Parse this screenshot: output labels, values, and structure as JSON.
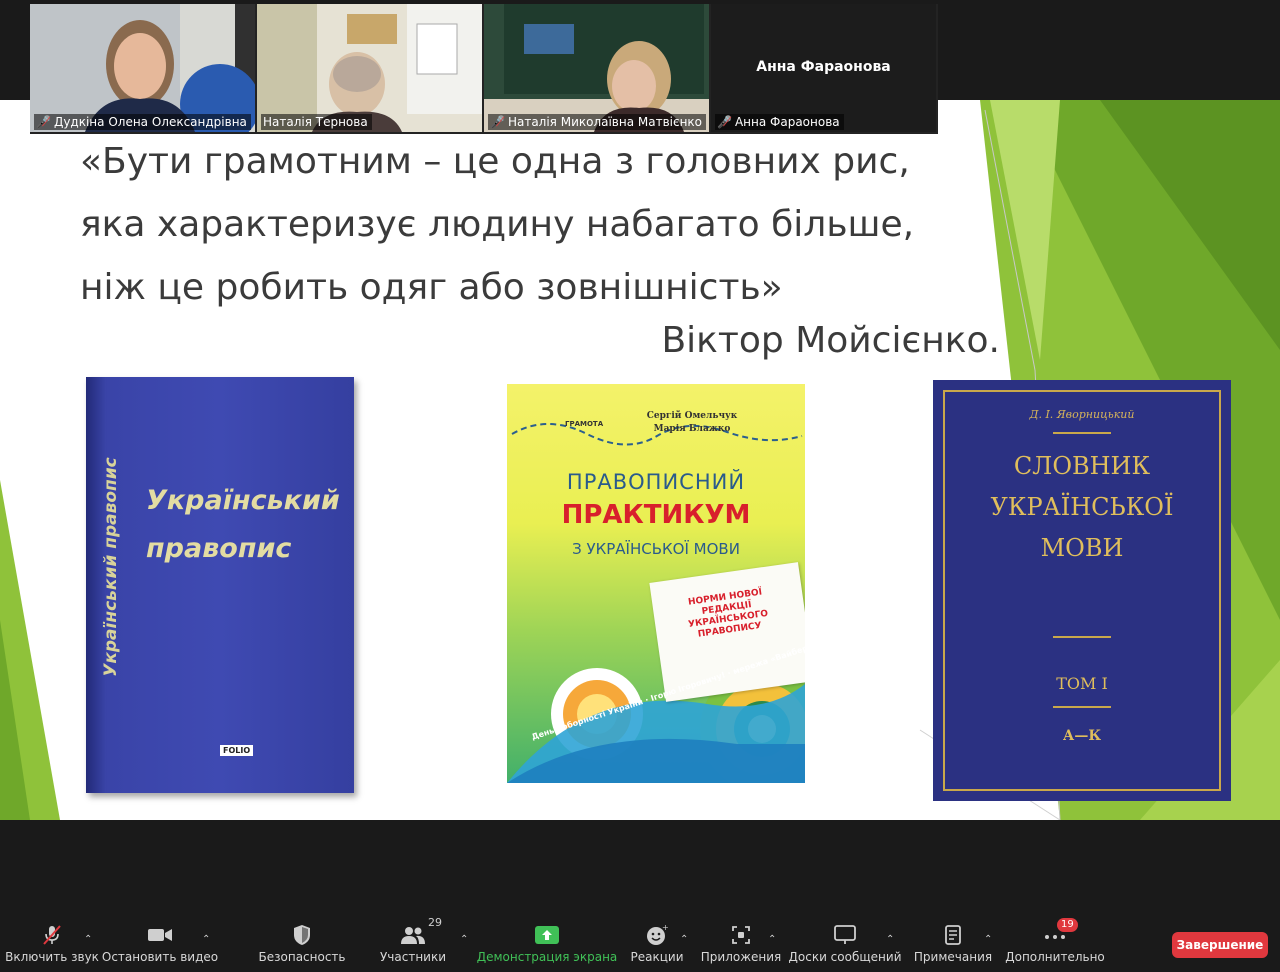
{
  "participants": [
    {
      "name": "Дудкіна Олена Олександрівна",
      "muted": true,
      "video": true
    },
    {
      "name": "Наталія Тернова",
      "muted": false,
      "video": true,
      "active": true
    },
    {
      "name": "Наталія Миколаївна Матвієнко",
      "muted": true,
      "video": true
    },
    {
      "name": "Анна Фараонова",
      "muted": true,
      "video": false,
      "display_name": "Анна Фараонова"
    }
  ],
  "slide": {
    "quote_lines": [
      "«Бути грамотним – це одна з головних рис,",
      "яка характеризує людину набагато більше,",
      "ніж це робить одяг або зовнішність»"
    ],
    "author": "Віктор Мойсієнко.",
    "books": {
      "book1": {
        "title_line1": "Український",
        "title_line2": "правопис",
        "spine": "Український правопис",
        "publisher": "FOLIO"
      },
      "book2": {
        "authors_line1": "Сергій Омельчук",
        "authors_line2": "Марія Блажко",
        "publisher": "ГРАМОТА",
        "title_line1": "ПРАВОПИСНИЙ",
        "title_line2": "ПРАКТИКУМ",
        "title_line3": "З УКРАЇНСЬКОЇ МОВИ",
        "note": "НОРМИ НОВОЇ РЕДАКЦІЇ УКРАЇНСЬКОГО ПРАВОПИСУ",
        "ribbon": "День Соборності України · Ігорю Ігоровичу! · мережа «Вайбер»"
      },
      "book3": {
        "author": "Д. І. Яворницький",
        "title_line1": "СЛОВНИК",
        "title_line2": "УКРАЇНСЬКОЇ",
        "title_line3": "МОВИ",
        "volume": "ТОМ І",
        "range": "А—К"
      }
    }
  },
  "toolbar": {
    "mute": {
      "label": "Включить звук",
      "icon": "microphone-muted-icon"
    },
    "video": {
      "label": "Остановить видео",
      "icon": "video-camera-icon"
    },
    "security": {
      "label": "Безопасность",
      "icon": "shield-icon"
    },
    "participants": {
      "label": "Участники",
      "icon": "participants-icon",
      "count": "29"
    },
    "share": {
      "label": "Демонстрация экрана",
      "icon": "share-screen-icon"
    },
    "reactions": {
      "label": "Реакции",
      "icon": "smiley-icon"
    },
    "apps": {
      "label": "Приложения",
      "icon": "apps-icon"
    },
    "whiteboards": {
      "label": "Доски сообщений",
      "icon": "whiteboard-icon"
    },
    "notes": {
      "label": "Примечания",
      "icon": "notes-icon"
    },
    "more": {
      "label": "Дополнительно",
      "icon": "more-icon",
      "badge": "19"
    },
    "end": {
      "label": "Завершение"
    }
  },
  "colors": {
    "accent_green": "#40c057",
    "end_red": "#e0383e",
    "slide_green": "#8fc23a"
  }
}
